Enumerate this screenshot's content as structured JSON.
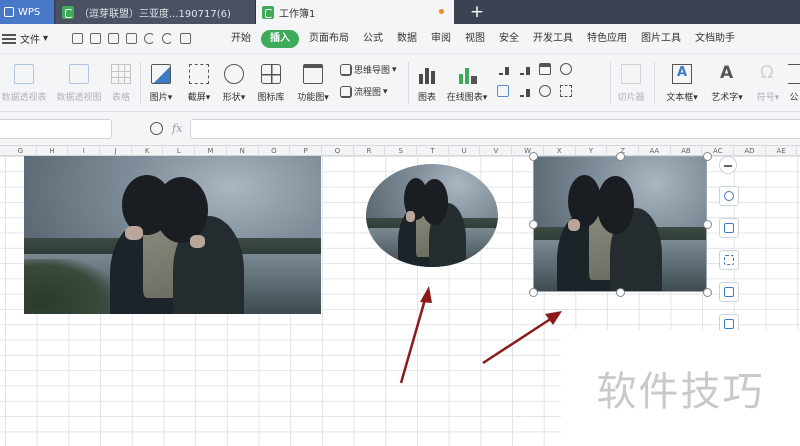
{
  "tabs": {
    "app": "WPS",
    "doc1": "（逗芽联盟）三亚度...190717(6)",
    "active": "工作簿1",
    "new_tab": "+"
  },
  "menubar": {
    "file": "文件",
    "file_arrow": "▾",
    "items": [
      "开始",
      "插入",
      "页面布局",
      "公式",
      "数据",
      "审阅",
      "视图",
      "安全",
      "开发工具",
      "特色应用",
      "图片工具",
      "文档助手"
    ],
    "active": "插入"
  },
  "ribbon": {
    "pivot_table": "数据透视表",
    "pivot_chart": "数据透视图",
    "table": "表格",
    "picture": "图片",
    "screenshot": "截屏",
    "shapes": "形状",
    "icon_lib": "图标库",
    "func_chart": "功能图",
    "mindmap": "思维导图",
    "flowchart": "流程图",
    "chart": "图表",
    "online_chart": "在线图表",
    "slicer": "切片器",
    "textbox": "文本框",
    "wordart": "艺术字",
    "symbol": "符号",
    "formula_trunc": "公",
    "dropdown": "▾"
  },
  "formula": {
    "fx": "fx",
    "namebox_value": "",
    "content": ""
  },
  "columns": [
    "G",
    "H",
    "I",
    "J",
    "K",
    "L",
    "M",
    "N",
    "O",
    "P",
    "Q",
    "R",
    "S",
    "T",
    "U",
    "V",
    "W",
    "X",
    "Y",
    "Z",
    "AA",
    "AB",
    "AC",
    "AD",
    "AE"
  ],
  "watermark": "软件技巧",
  "colors": {
    "accent_green": "#3faa5a",
    "tab_blue": "#4a78c8",
    "arrow_red": "#8b1a1a"
  }
}
